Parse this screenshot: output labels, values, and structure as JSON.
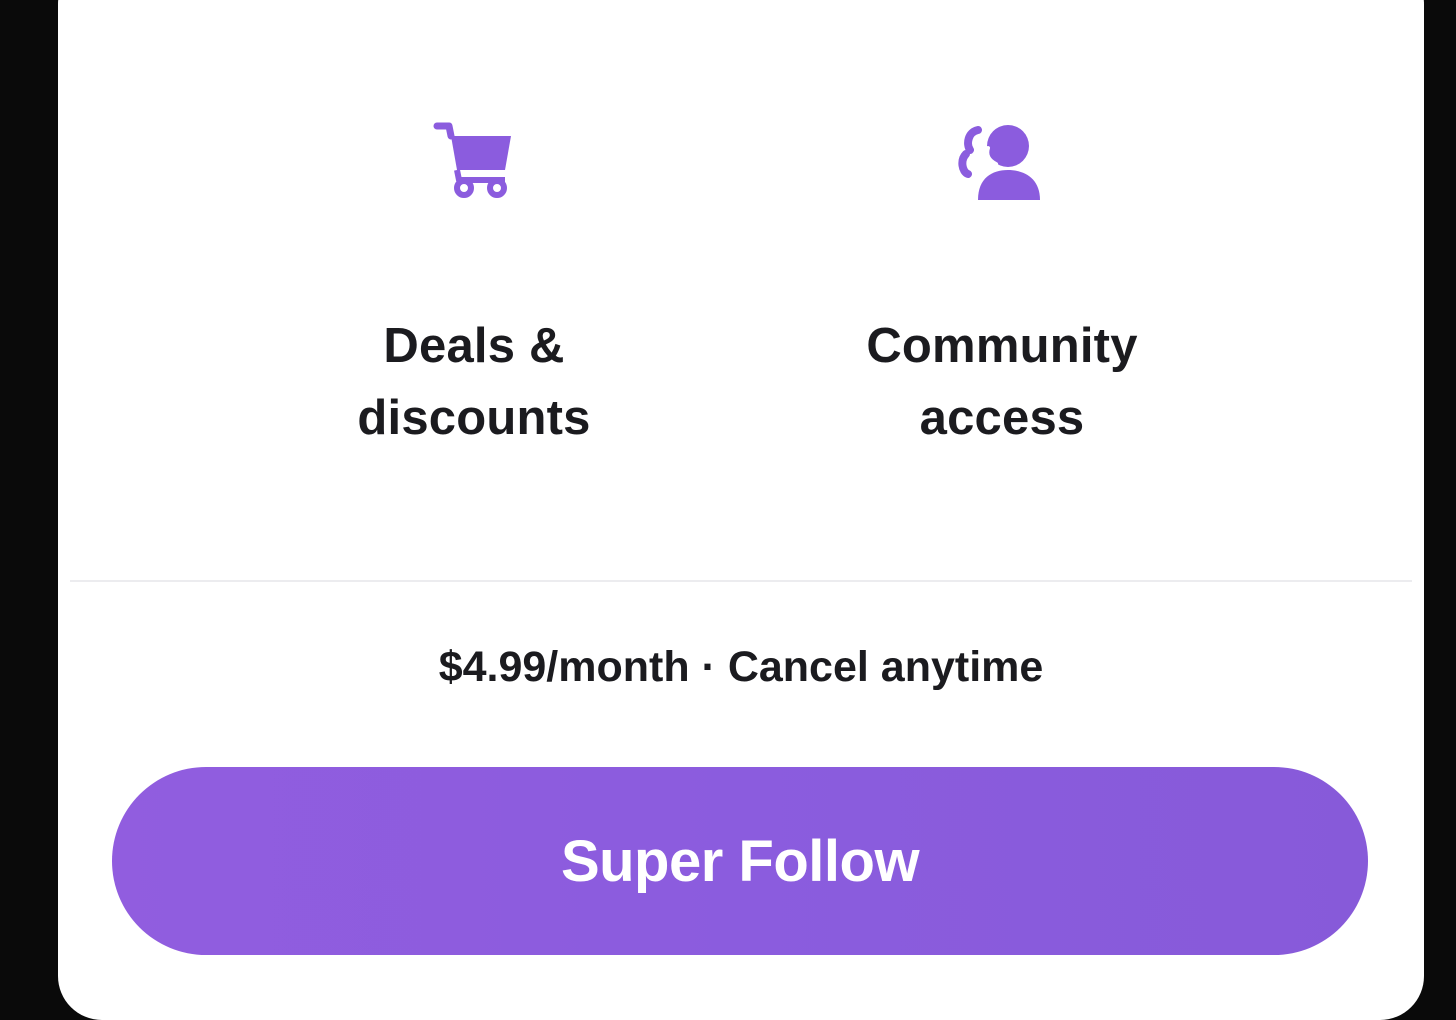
{
  "features": [
    {
      "icon": "shopping-cart-icon",
      "label_lines": [
        "Deals &",
        "discounts"
      ]
    },
    {
      "icon": "community-people-icon",
      "label_lines": [
        "Community",
        "access"
      ]
    }
  ],
  "pricing": {
    "text": "$4.99/month · Cancel anytime"
  },
  "cta": {
    "label": "Super Follow"
  },
  "colors": {
    "accent": "#8b5cde",
    "text": "#1b1b1f",
    "background": "#ffffff",
    "frame": "#0a0a0a"
  }
}
